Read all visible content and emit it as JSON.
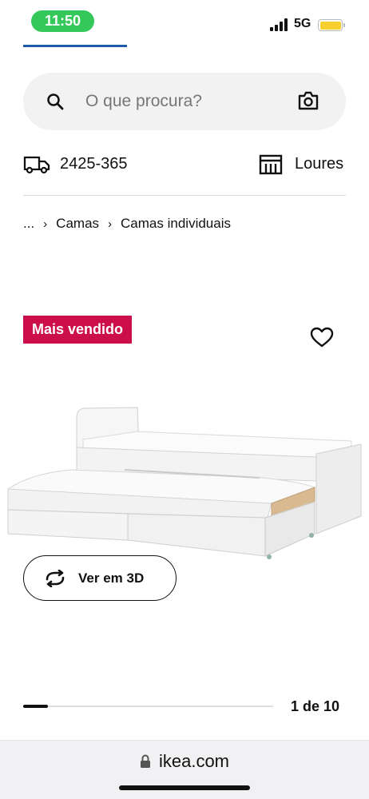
{
  "status_bar": {
    "time": "11:50",
    "network": "5G",
    "signal_icon": "cellular-signal-icon",
    "battery_icon": "battery-icon"
  },
  "colors": {
    "time_pill": "#34c759",
    "brand_blue": "#1f5cab",
    "badge": "#cc0f4b",
    "battery": "#f7cf2f"
  },
  "search": {
    "placeholder": "O que procura?",
    "value": "",
    "icon": "search-icon",
    "camera_icon": "camera-icon"
  },
  "delivery": {
    "postal_code": "2425-365",
    "store": "Loures",
    "truck_icon": "truck-icon",
    "store_icon": "store-icon"
  },
  "breadcrumb": {
    "items": [
      "...",
      "Camas",
      "Camas individuais"
    ]
  },
  "product": {
    "badge": "Mais vendido",
    "wishlist_icon": "heart-icon",
    "image": "white-bed-with-pull-out-bed"
  },
  "view_3d": {
    "label": "Ver em 3D",
    "icon": "rotate-3d-icon"
  },
  "carousel": {
    "position_text": "1 de 10",
    "current": 1,
    "total": 10
  },
  "browser": {
    "url": "ikea.com",
    "lock_icon": "lock-icon"
  }
}
